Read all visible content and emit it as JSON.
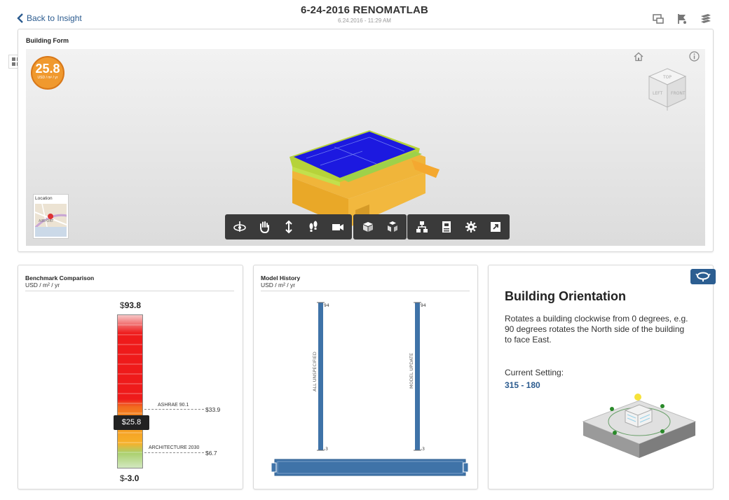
{
  "header": {
    "back_label": "Back to Insight",
    "title": "6-24-2016 RENOMATLAB",
    "subtitle": "6.24.2016 - 11:29 AM"
  },
  "building_form": {
    "title": "Building Form",
    "score": {
      "value": "25.8",
      "unit": "USD / m² / yr"
    },
    "location_label": "Location",
    "map_text": "AIRPORT"
  },
  "benchmark": {
    "title": "Benchmark Comparison",
    "unit": "USD / m² / yr",
    "max_prefix": "$",
    "max_value": "93.8",
    "min_prefix": "$",
    "min_value": "-3.0",
    "current": "$25.8",
    "refs": [
      {
        "label": "ASHRAE 90.1",
        "value": "$33.9"
      },
      {
        "label": "ARCHITECTURE 2030",
        "value": "$6.7"
      }
    ]
  },
  "model_history": {
    "title": "Model History",
    "unit": "USD / m² / yr",
    "bars": [
      {
        "label": "ALL UNSPECIFIED",
        "top": "94",
        "bottom": "-3"
      },
      {
        "label": "MODEL UPDATE",
        "top": "94",
        "bottom": "-3"
      }
    ]
  },
  "orientation": {
    "title": "Building Orientation",
    "description": "Rotates a building clockwise from 0 degrees, e.g. 90 degrees rotates the North side of the building to face East.",
    "setting_label": "Current Setting:",
    "setting_value": "315 - 180"
  },
  "colors": {
    "accent": "#2b5b8f",
    "badge": "#f0992e",
    "toolbar": "#3a3a3a",
    "history_bar": "#3f73a8"
  },
  "icons": [
    "back-chevron-icon",
    "compare-icon",
    "flag-icon",
    "layers-icon",
    "home-icon",
    "info-icon",
    "viewcube-icon",
    "orbit-icon",
    "pan-icon",
    "zoom-icon",
    "walk-icon",
    "camera-icon",
    "section-box-icon",
    "explode-icon",
    "model-tree-icon",
    "properties-icon",
    "settings-icon",
    "fullscreen-icon",
    "orientation-badge-icon"
  ]
}
